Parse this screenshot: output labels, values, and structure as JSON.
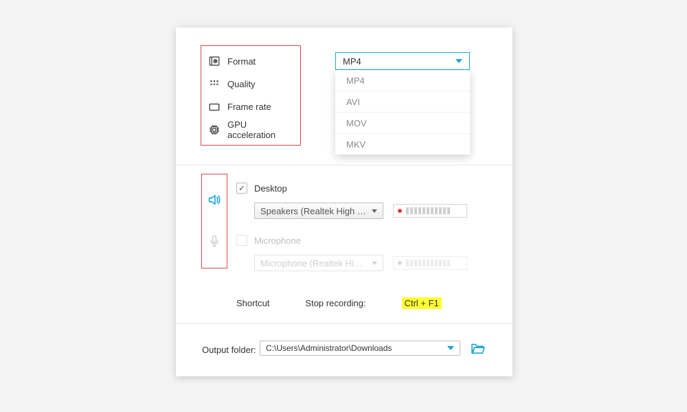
{
  "settings": {
    "items": [
      {
        "label": "Format"
      },
      {
        "label": "Quality"
      },
      {
        "label": "Frame rate"
      },
      {
        "label": "GPU acceleration"
      }
    ]
  },
  "format": {
    "selected": "MP4",
    "options": [
      "MP4",
      "AVI",
      "MOV",
      "MKV"
    ]
  },
  "audio": {
    "desktop": {
      "label": "Desktop",
      "checked": true,
      "device": "Speakers (Realtek High De..."
    },
    "microphone": {
      "label": "Microphone",
      "checked": false,
      "device": "Microphone (Realtek High ..."
    }
  },
  "shortcut": {
    "title": "Shortcut",
    "label": "Stop recording:",
    "key": "Ctrl + F1"
  },
  "output": {
    "label": "Output folder:",
    "path": "C:\\Users\\Administrator\\Downloads"
  }
}
